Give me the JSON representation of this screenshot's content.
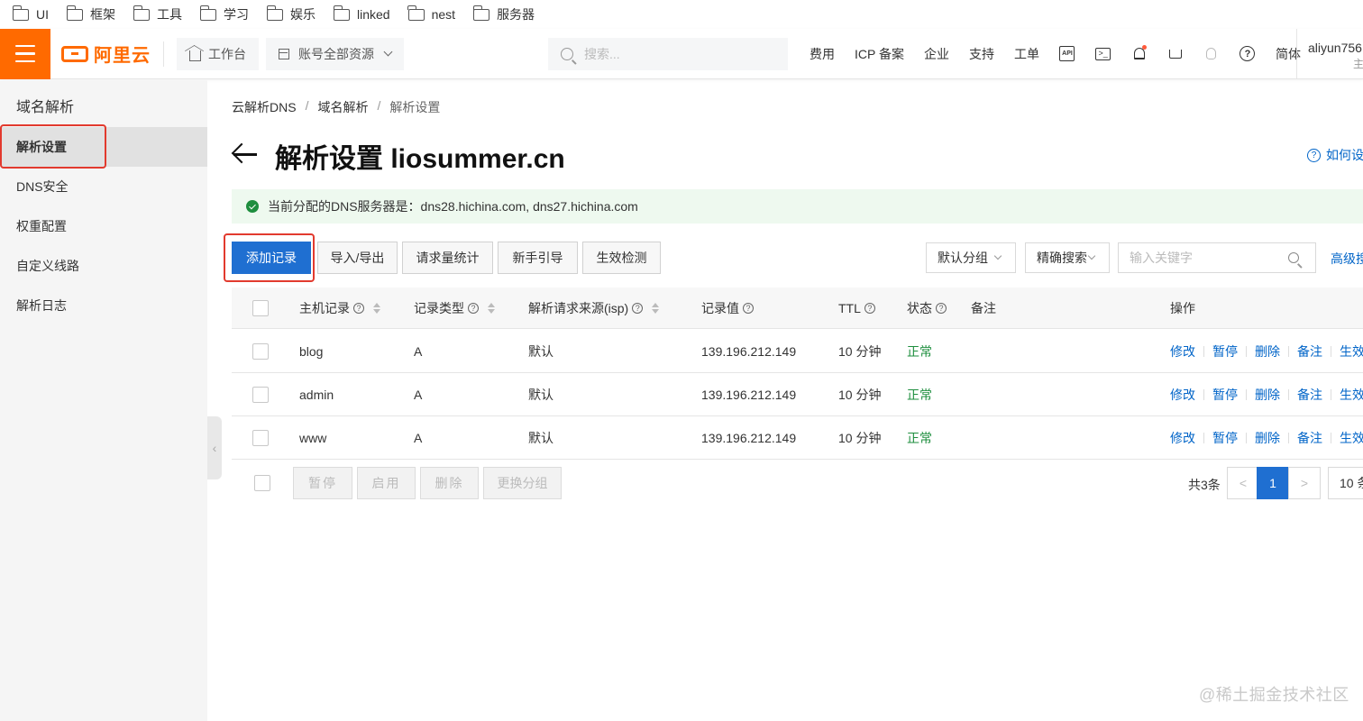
{
  "bookmarks": [
    "UI",
    "框架",
    "工具",
    "学习",
    "娱乐",
    "linked",
    "nest",
    "服务器"
  ],
  "topbar": {
    "logo_text": "阿里云",
    "workbench": "工作台",
    "resource_selector": "账号全部资源",
    "search_placeholder": "搜索...",
    "nav": [
      "费用",
      "ICP 备案",
      "企业",
      "支持",
      "工单"
    ],
    "icons": [
      "api-icon",
      "terminal-icon",
      "bell-icon",
      "cart-icon",
      "bulb-icon",
      "help-icon"
    ],
    "lang": "简体",
    "user": "aliyun756",
    "user_sub": "主"
  },
  "sidebar": {
    "title": "域名解析",
    "items": [
      {
        "label": "解析设置",
        "active": true
      },
      {
        "label": "DNS安全",
        "active": false
      },
      {
        "label": "权重配置",
        "active": false
      },
      {
        "label": "自定义线路",
        "active": false
      },
      {
        "label": "解析日志",
        "active": false
      }
    ]
  },
  "breadcrumb": [
    "云解析DNS",
    "域名解析",
    "解析设置"
  ],
  "page": {
    "title": "解析设置 liosummer.cn",
    "howto": "如何设",
    "notice": "当前分配的DNS服务器是：dns28.hichina.com, dns27.hichina.com"
  },
  "toolbar": {
    "add": "添加记录",
    "import_export": "导入/导出",
    "stats": "请求量统计",
    "guide": "新手引导",
    "check": "生效检测",
    "group_select": "默认分组",
    "search_mode": "精确搜索",
    "keyword_placeholder": "输入关键字",
    "advanced": "高级搜"
  },
  "table": {
    "headers": {
      "host": "主机记录",
      "type": "记录类型",
      "isp": "解析请求来源(isp)",
      "value": "记录值",
      "ttl": "TTL",
      "status": "状态",
      "remark": "备注",
      "ops": "操作"
    },
    "rows": [
      {
        "host": "blog",
        "type": "A",
        "isp": "默认",
        "value": "139.196.212.149",
        "ttl": "10 分钟",
        "status": "正常",
        "remark": ""
      },
      {
        "host": "admin",
        "type": "A",
        "isp": "默认",
        "value": "139.196.212.149",
        "ttl": "10 分钟",
        "status": "正常",
        "remark": ""
      },
      {
        "host": "www",
        "type": "A",
        "isp": "默认",
        "value": "139.196.212.149",
        "ttl": "10 分钟",
        "status": "正常",
        "remark": ""
      }
    ],
    "row_ops": [
      "修改",
      "暂停",
      "删除",
      "备注",
      "生效检"
    ]
  },
  "footer": {
    "batch": [
      "暂停",
      "启用",
      "删除",
      "更换分组"
    ],
    "total": "共3条",
    "prev": "<",
    "page": "1",
    "next": ">",
    "pagesize": "10 条"
  },
  "watermark": "@稀土掘金技术社区",
  "colors": {
    "brand": "#ff6a00",
    "primary": "#1f6fd1",
    "link": "#0064c8",
    "success": "#1e8e3e",
    "highlight": "#e23a2e"
  }
}
